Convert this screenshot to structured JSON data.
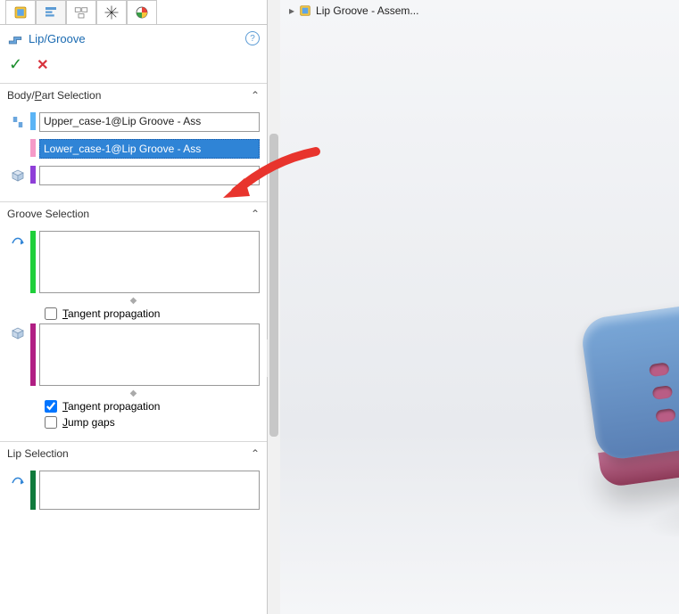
{
  "header": {
    "feature_name": "Lip/Groove"
  },
  "breadcrumb": {
    "label": "Lip Groove - Assem..."
  },
  "body_part_selection": {
    "title": "Body/Part Selection",
    "upper_value": "Upper_case-1@Lip Groove - Ass",
    "lower_value": "Lower_case-1@Lip Groove - Ass",
    "body_value": ""
  },
  "groove_selection": {
    "title": "Groove Selection",
    "tangent1_label": "Tangent propagation",
    "tangent1_checked": false,
    "tangent2_label": "Tangent propagation",
    "tangent2_checked": true,
    "jump_gaps_label": "Jump gaps",
    "jump_gaps_checked": false
  },
  "lip_selection": {
    "title": "Lip Selection"
  }
}
